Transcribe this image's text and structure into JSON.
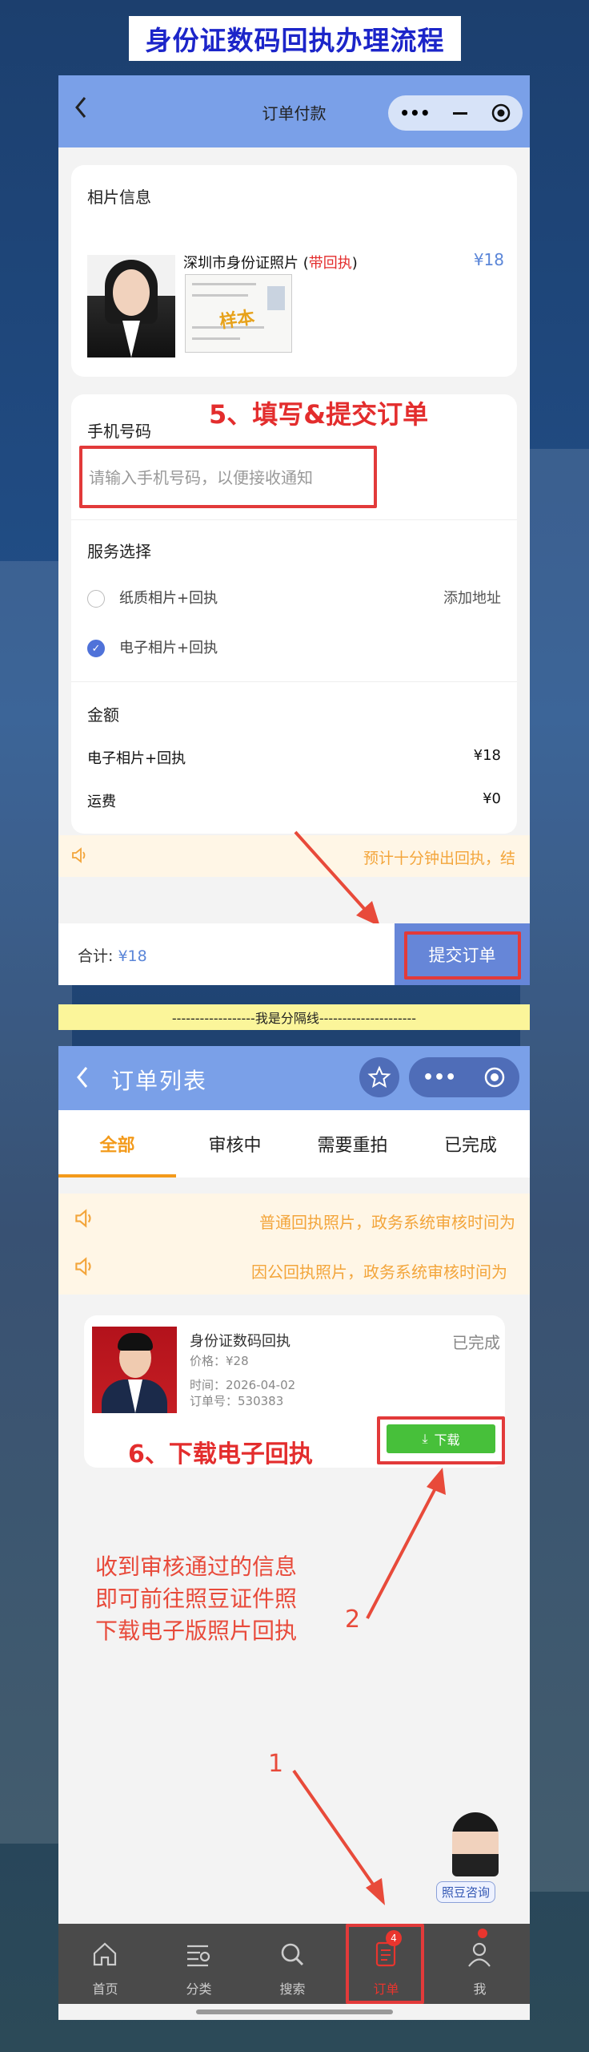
{
  "page_title": "身份证数码回执办理流程",
  "screen1": {
    "nav_title": "订单付款",
    "photo_info_label": "相片信息",
    "product_name": "深圳市身份证照片",
    "product_tag_open": "(",
    "product_tag": "带回执",
    "product_tag_close": ")",
    "product_price": "¥18",
    "sample_stamp": "样本",
    "step5_annotation": "5、填写&提交订单",
    "phone_label": "手机号码",
    "phone_placeholder": "请输入手机号码，以便接收通知",
    "service_label": "服务选择",
    "service_options": [
      {
        "label": "纸质相片+回执",
        "selected": false,
        "extra": "添加地址"
      },
      {
        "label": "电子相片+回执",
        "selected": true
      }
    ],
    "amount_label": "金额",
    "amount_rows": [
      {
        "label": "电子相片+回执",
        "value": "¥18"
      },
      {
        "label": "运费",
        "value": "¥0"
      }
    ],
    "notice_text": "预计十分钟出回执，结",
    "total_label": "合计:",
    "total_value": "¥18",
    "submit_label": "提交订单"
  },
  "separator_text": "------------------我是分隔线---------------------",
  "screen2": {
    "nav_title": "订单列表",
    "tabs": [
      "全部",
      "审核中",
      "需要重拍",
      "已完成"
    ],
    "notices": [
      "普通回执照片，政务系统审核时间为",
      "因公回执照片，政务系统审核时间为"
    ],
    "order": {
      "title": "身份证数码回执",
      "status": "已完成",
      "price": "价格：¥28",
      "time": "时间：2026-04-02",
      "order_no": "订单号：530383",
      "download_label": "下载"
    },
    "step6_annotation": "6、下载电子回执",
    "instruction_lines": [
      "收到审核通过的信息",
      "即可前往照豆证件照",
      "下载电子版照片回执"
    ],
    "marker_1": "1",
    "marker_2": "2",
    "consult_label": "照豆咨询",
    "tabbar": [
      {
        "label": "首页",
        "icon": "home-icon"
      },
      {
        "label": "分类",
        "icon": "list-icon"
      },
      {
        "label": "搜索",
        "icon": "search-icon"
      },
      {
        "label": "订单",
        "icon": "order-icon",
        "badge": "4"
      },
      {
        "label": "我",
        "icon": "user-icon"
      }
    ]
  },
  "colors": {
    "nav_blue": "#7aa0e8",
    "accent_red": "#e32d2d",
    "accent_orange": "#f39a1b",
    "download_green": "#47c03a",
    "title_blue": "#1c25c9"
  }
}
